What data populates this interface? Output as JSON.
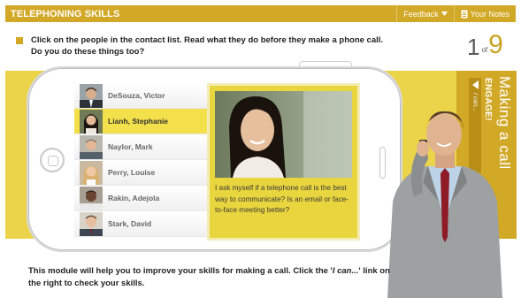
{
  "header": {
    "title": "TELEPHONING SKILLS",
    "feedback_label": "Feedback",
    "notes_label": "Your Notes"
  },
  "instruction": {
    "text": "Click on the people in the contact list. Read what they do before they make a phone call. Do you do these things too?"
  },
  "counter": {
    "current": "1",
    "of": "of",
    "total": "9"
  },
  "side_panel": {
    "title": "Making a call",
    "subtitle": "ENGAGE!",
    "ican_label": "I can..."
  },
  "contacts": [
    {
      "name": "DeSouza, Victor",
      "active": false
    },
    {
      "name": "Lianh, Stephanie",
      "active": true
    },
    {
      "name": "Naylor, Mark",
      "active": false
    },
    {
      "name": "Perry, Louise",
      "active": false
    },
    {
      "name": "Rakin, Adejola",
      "active": false
    },
    {
      "name": "Stark, David",
      "active": false
    }
  ],
  "detail": {
    "quote": "I ask myself if a telephone call is the best way to communicate? Is an email or face-to-face meeting better?"
  },
  "footer": {
    "text_before": "This module will help you to improve your skills for making a call. Click the '",
    "link_text": "I can...",
    "text_after": "' link on the right to check your skills."
  },
  "colors": {
    "header_gold": "#d2a827",
    "band_yellow": "#ebd44a",
    "active_contact": "#f3e04a"
  },
  "icons": [
    "chevron-down-icon",
    "notes-icon",
    "triangle-left-icon",
    "home-button-icon"
  ]
}
